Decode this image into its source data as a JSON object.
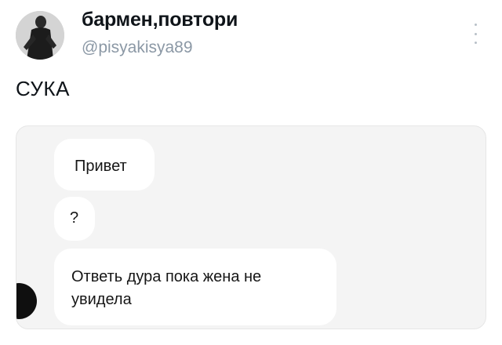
{
  "tweet": {
    "display_name": "бармен,повтори",
    "handle": "@pisyakisya89",
    "text": "СУКА",
    "more_icon": "more-vertical-icon"
  },
  "screenshot": {
    "messages": [
      {
        "text": "Привет"
      },
      {
        "text": "?"
      },
      {
        "text": "Ответь дура пока жена не увидела"
      }
    ]
  },
  "colors": {
    "handle": "#8b98a5",
    "media_background": "#f4f4f4",
    "bubble": "#ffffff",
    "sender_avatar": "#0f0f0f"
  }
}
